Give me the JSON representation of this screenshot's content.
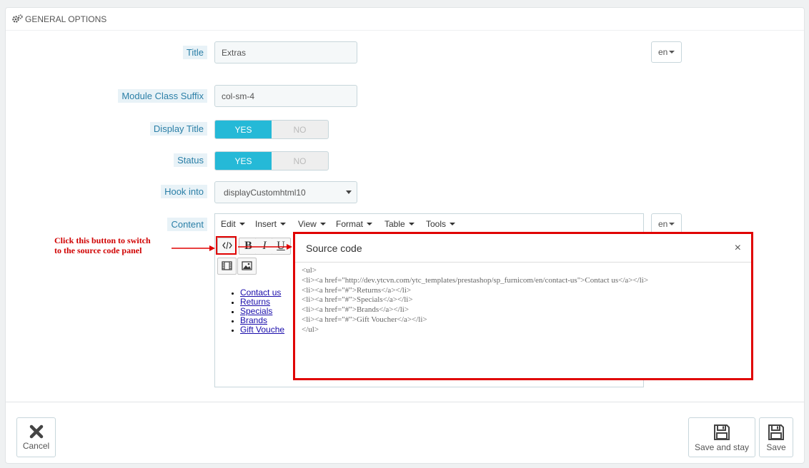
{
  "panel": {
    "heading": "General Options"
  },
  "fields": {
    "title": {
      "label": "Title",
      "value": "Extras",
      "lang": "en"
    },
    "class_suffix": {
      "label": "Module Class Suffix",
      "value": "col-sm-4"
    },
    "display_title": {
      "label": "Display Title",
      "yes": "YES",
      "no": "NO",
      "selected": "YES"
    },
    "status": {
      "label": "Status",
      "yes": "YES",
      "no": "NO",
      "selected": "YES"
    },
    "hook": {
      "label": "Hook into",
      "value": "displayCustomhtml10"
    },
    "content": {
      "label": "Content",
      "lang": "en"
    }
  },
  "editor": {
    "menu": [
      "Edit",
      "Insert",
      "View",
      "Format",
      "Table",
      "Tools"
    ],
    "toolbar": {
      "source_icon": "code-icon",
      "bold": "B",
      "italic": "I",
      "underline": "U",
      "media_icon": "film-icon",
      "image_icon": "image-icon"
    },
    "links": [
      "Contact us",
      "Returns",
      "Specials",
      "Brands",
      "Gift Vouche"
    ]
  },
  "dialog": {
    "title": "Source code",
    "close": "×",
    "code": "<ul>\n<li><a href=\"http://dev.ytcvn.com/ytc_templates/prestashop/sp_furnicom/en/contact-us\">Contact us</a></li>\n<li><a href=\"#\">Returns</a></li>\n<li><a href=\"#\">Specials</a></li>\n<li><a href=\"#\">Brands</a></li>\n<li><a href=\"#\">Gift Voucher</a></li>\n</ul>"
  },
  "annotation": {
    "line1": "Click this button to switch",
    "line2": "to the source code panel",
    "color": "#e00000"
  },
  "footer": {
    "cancel": "Cancel",
    "save_stay": "Save and stay",
    "save": "Save"
  },
  "colors": {
    "accent": "#25b9d7",
    "label_text": "#2b7fa7",
    "label_bg": "#e8f2f7"
  }
}
